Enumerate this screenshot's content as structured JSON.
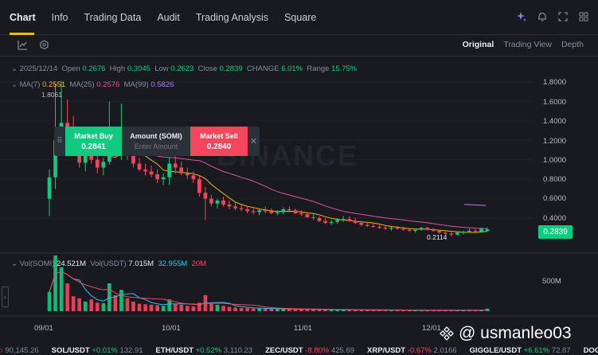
{
  "tabs": [
    {
      "label": "Chart"
    },
    {
      "label": "Info"
    },
    {
      "label": "Trading Data"
    },
    {
      "label": "Audit"
    },
    {
      "label": "Trading Analysis"
    },
    {
      "label": "Square"
    }
  ],
  "view_modes": [
    "Original",
    "Trading View",
    "Depth"
  ],
  "ohlc": {
    "date": "2025/12/14",
    "open_label": "Open",
    "open": "0.2676",
    "high_label": "High",
    "high": "0.3045",
    "low_label": "Low",
    "low": "0.2623",
    "close_label": "Close",
    "close": "0.2839",
    "change_label": "CHANGE",
    "change": "6.01%",
    "range_label": "Range",
    "range": "15.75%"
  },
  "ma": {
    "ma7_label": "MA(7)",
    "ma7": "0.2551",
    "ma25_label": "MA(25)",
    "ma25": "0.2576",
    "ma99_label": "MA(99)",
    "ma99": "0.5826"
  },
  "high_marker": "1.8061",
  "low_marker": "0.2114",
  "watermark": "BINANCE",
  "trade_panel": {
    "buy_label": "Market Buy",
    "buy_price": "0.2841",
    "amount_label": "Amount (SOMI)",
    "amount_placeholder": "Enter Amount",
    "sell_label": "Market Sell",
    "sell_price": "0.2840"
  },
  "price_axis": [
    "1.8000",
    "1.6000",
    "1.4000",
    "1.2000",
    "1.0000",
    "0.8000",
    "0.6000",
    "0.4000"
  ],
  "current_price": "0.2839",
  "volume": {
    "vol_label": "Vol(SOMI)",
    "vol_value": "24.521M",
    "vol_usdt_label": "Vol(USDT)",
    "vol_usdt_value": "7.015M",
    "ma_a": "32.955M",
    "ma_b": "20M"
  },
  "volume_axis": "500M",
  "x_axis": [
    "09/01",
    "10/01",
    "11/01",
    "12/01"
  ],
  "ticker": [
    {
      "name": "",
      "change": "",
      "price": "90,145.26"
    },
    {
      "name": "SOL/USDT",
      "change": "+0.01%",
      "price": "132.91"
    },
    {
      "name": "ETH/USDT",
      "change": "+0.52%",
      "price": "3,110.23"
    },
    {
      "name": "ZEC/USDT",
      "change": "-8.80%",
      "price": "425.69"
    },
    {
      "name": "XRP/USDT",
      "change": "-0.67%",
      "price": "2.0166"
    },
    {
      "name": "GIGGLE/USDT",
      "change": "+6.61%",
      "price": "72.87"
    },
    {
      "name": "DOGE/US",
      "change": "",
      "price": ""
    }
  ],
  "user_watermark": "@ usmanleo03",
  "colors": {
    "up": "#0ecb81",
    "down": "#f6465d",
    "accent": "#f0b90b",
    "ma7": "#f0b90b",
    "ma25": "#e24fa0",
    "ma99": "#b27cf7"
  },
  "chart_data": {
    "type": "candlestick",
    "pair": "SOMI/USDT",
    "interval": "1D",
    "ylim": [
      0.2,
      1.9
    ],
    "x_ticks": [
      "09/01",
      "10/01",
      "11/01",
      "12/01"
    ],
    "candles": [
      [
        0.6,
        0.9,
        0.42,
        0.82
      ],
      [
        0.82,
        1.78,
        0.7,
        1.2
      ],
      [
        1.2,
        1.81,
        1.05,
        1.38
      ],
      [
        1.38,
        1.62,
        1.22,
        1.3
      ],
      [
        1.3,
        1.45,
        1.08,
        1.18
      ],
      [
        1.18,
        1.24,
        0.92,
        0.97
      ],
      [
        0.97,
        1.12,
        0.88,
        1.05
      ],
      [
        1.05,
        1.18,
        0.96,
        1.0
      ],
      [
        1.0,
        1.08,
        0.86,
        0.92
      ],
      [
        0.92,
        1.02,
        0.84,
        0.98
      ],
      [
        0.98,
        1.6,
        0.95,
        1.16
      ],
      [
        1.16,
        1.3,
        1.02,
        1.08
      ],
      [
        1.08,
        1.58,
        1.0,
        1.25
      ],
      [
        1.25,
        1.3,
        1.0,
        1.05
      ],
      [
        1.05,
        1.12,
        0.92,
        0.96
      ],
      [
        0.96,
        1.02,
        0.88,
        0.9
      ],
      [
        0.9,
        0.96,
        0.84,
        0.88
      ],
      [
        0.88,
        0.94,
        0.82,
        0.85
      ],
      [
        0.85,
        0.9,
        0.76,
        0.8
      ],
      [
        0.8,
        0.86,
        0.74,
        0.82
      ],
      [
        0.82,
        1.03,
        0.74,
        0.96
      ],
      [
        0.96,
        1.05,
        0.86,
        0.92
      ],
      [
        0.92,
        0.98,
        0.84,
        0.86
      ],
      [
        0.86,
        0.92,
        0.8,
        0.84
      ],
      [
        0.84,
        0.88,
        0.76,
        0.8
      ],
      [
        0.8,
        0.84,
        0.62,
        0.66
      ],
      [
        0.66,
        0.72,
        0.38,
        0.6
      ],
      [
        0.6,
        0.64,
        0.52,
        0.55
      ],
      [
        0.55,
        0.6,
        0.5,
        0.58
      ],
      [
        0.58,
        0.62,
        0.52,
        0.54
      ],
      [
        0.54,
        0.58,
        0.49,
        0.52
      ],
      [
        0.52,
        0.56,
        0.48,
        0.5
      ],
      [
        0.5,
        0.54,
        0.47,
        0.49
      ],
      [
        0.49,
        0.52,
        0.45,
        0.47
      ],
      [
        0.47,
        0.5,
        0.44,
        0.46
      ],
      [
        0.46,
        0.5,
        0.43,
        0.48
      ],
      [
        0.48,
        0.52,
        0.45,
        0.47
      ],
      [
        0.47,
        0.5,
        0.44,
        0.45
      ],
      [
        0.45,
        0.48,
        0.43,
        0.46
      ],
      [
        0.46,
        0.51,
        0.44,
        0.49
      ],
      [
        0.49,
        0.52,
        0.46,
        0.48
      ],
      [
        0.48,
        0.5,
        0.44,
        0.45
      ],
      [
        0.45,
        0.48,
        0.42,
        0.44
      ],
      [
        0.44,
        0.46,
        0.4,
        0.41
      ],
      [
        0.41,
        0.44,
        0.38,
        0.4
      ],
      [
        0.4,
        0.42,
        0.36,
        0.37
      ],
      [
        0.37,
        0.4,
        0.34,
        0.35
      ],
      [
        0.35,
        0.38,
        0.33,
        0.36
      ],
      [
        0.36,
        0.4,
        0.34,
        0.38
      ],
      [
        0.38,
        0.42,
        0.36,
        0.39
      ],
      [
        0.39,
        0.42,
        0.36,
        0.37
      ],
      [
        0.37,
        0.4,
        0.34,
        0.35
      ],
      [
        0.35,
        0.37,
        0.32,
        0.33
      ],
      [
        0.33,
        0.36,
        0.31,
        0.32
      ],
      [
        0.32,
        0.34,
        0.3,
        0.31
      ],
      [
        0.31,
        0.33,
        0.29,
        0.3
      ],
      [
        0.3,
        0.32,
        0.28,
        0.29
      ],
      [
        0.29,
        0.31,
        0.27,
        0.3
      ],
      [
        0.3,
        0.32,
        0.28,
        0.29
      ],
      [
        0.29,
        0.31,
        0.27,
        0.28
      ],
      [
        0.28,
        0.3,
        0.26,
        0.27
      ],
      [
        0.27,
        0.29,
        0.25,
        0.28
      ],
      [
        0.28,
        0.31,
        0.27,
        0.3
      ],
      [
        0.3,
        0.31,
        0.27,
        0.28
      ],
      [
        0.28,
        0.3,
        0.26,
        0.27
      ],
      [
        0.27,
        0.28,
        0.24,
        0.25
      ],
      [
        0.25,
        0.27,
        0.23,
        0.24
      ],
      [
        0.24,
        0.26,
        0.2114,
        0.23
      ],
      [
        0.23,
        0.26,
        0.22,
        0.25
      ],
      [
        0.25,
        0.27,
        0.23,
        0.26
      ],
      [
        0.26,
        0.29,
        0.25,
        0.27
      ],
      [
        0.27,
        0.29,
        0.25,
        0.26
      ],
      [
        0.26,
        0.3,
        0.25,
        0.29
      ],
      [
        0.2676,
        0.3045,
        0.2623,
        0.2839
      ]
    ],
    "volumes": [
      180,
      520,
      410,
      260,
      140,
      120,
      90,
      110,
      80,
      75,
      260,
      150,
      200,
      120,
      90,
      70,
      65,
      60,
      55,
      50,
      110,
      70,
      60,
      50,
      45,
      80,
      150,
      70,
      60,
      50,
      40,
      35,
      30,
      28,
      25,
      25,
      24,
      22,
      20,
      22,
      20,
      18,
      18,
      17,
      16,
      15,
      15,
      14,
      14,
      14,
      13,
      13,
      12,
      12,
      11,
      11,
      10,
      10,
      10,
      10,
      10,
      9,
      10,
      9,
      9,
      9,
      9,
      10,
      9,
      9,
      10,
      9,
      11,
      24.5
    ]
  }
}
